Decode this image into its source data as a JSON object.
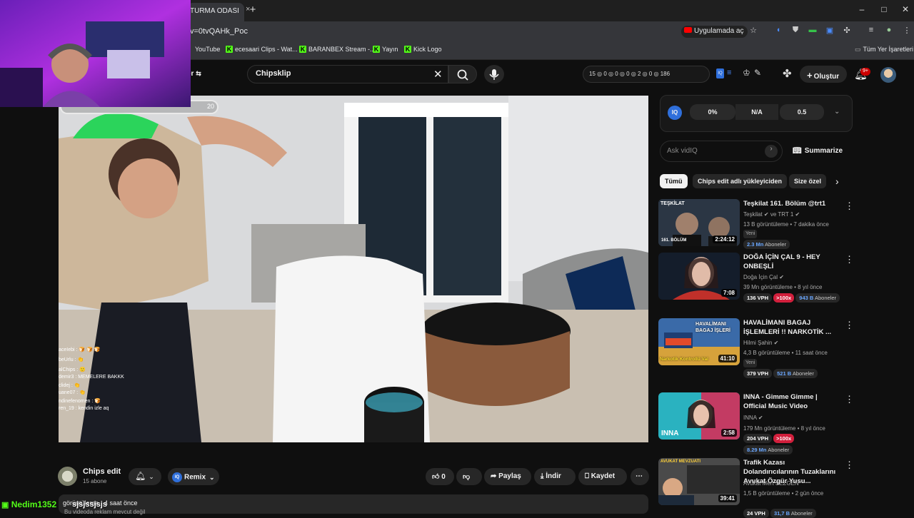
{
  "browser": {
    "tab_title": "TURMA ODASI",
    "tab_close": "×",
    "new_tab": "+",
    "window_controls": [
      "–",
      "□",
      "✕"
    ],
    "url": "v=0tvQAHk_Poc",
    "open_in_app": "Uygulamada aç",
    "bookmarks": [
      {
        "label": "YouTube",
        "icon": "youtube-icon"
      },
      {
        "label": "ecesaari Clips - Wat...",
        "icon": "kick-icon"
      },
      {
        "label": "BARANBEX Stream -...",
        "icon": "kick-icon"
      },
      {
        "label": "Yayın",
        "icon": "kick-icon"
      },
      {
        "label": "Kick Logo",
        "icon": "kick-icon"
      }
    ],
    "all_bookmarks": "Tüm Yer İşaretleri"
  },
  "youtube": {
    "filter_label": "er",
    "search_value": "Chipsklip",
    "vidiq_stats": "15 ◎ 0 ◎ 0 ◎ 0 ◎ 2 ◎ 0 ◎ 186",
    "create_label": "Oluştur",
    "notif_badge": "9+"
  },
  "video": {
    "viewer_count": "20",
    "chat": [
      "aceIebi : 🍞 🍞 🍞",
      "beUrlu : 👏",
      "alChips : 🙂",
      "demir3 : MEMELERE BAKKK",
      "clidej : 👏",
      "uane07 : 👏",
      "ndinefenomen : 🍞",
      "ren_19 : kendin izle aq"
    ]
  },
  "channel": {
    "name": "Chips edit",
    "subscribers": "15 abone",
    "remix_label": "Remix",
    "like_count": "0",
    "share_label": "Paylaş",
    "download_label": "İndir",
    "save_label": "Kaydet",
    "more": "⋯"
  },
  "description": {
    "meta": "görüntüleme · 4 saat önce",
    "sub": "Bu videoda reklam mevcut değil"
  },
  "stream_overlay": {
    "user": "Nedim1352",
    "message": "sjsjssjsjs"
  },
  "vidiq": {
    "logo": "IQ",
    "scores": [
      "0%",
      "N/A",
      "0.5"
    ],
    "ask_placeholder": "Ask vidIQ",
    "summarize_label": "Summarize"
  },
  "chips": [
    "Tümü",
    "Chips edit adlı yükleyiciden",
    "Size özel"
  ],
  "recommendations": [
    {
      "title": "Teşkilat 161. Bölüm @trt1",
      "channel": "Teşkilat ✔ ve TRT 1 ✔",
      "meta": "13 B görüntüleme • 7 dakika önce",
      "badge": "Yeni",
      "duration": "2:24:12",
      "vph": "",
      "mult": "",
      "subs_num": "2.3 Mn",
      "subs_label": "Aboneler",
      "thumb_color": "#2a3340",
      "thumb_text": "TEŞKİLAT",
      "thumb_sub": "161. BÖLÜM"
    },
    {
      "title": "DOĞA İÇİN ÇAL 9 - HEY ONBEŞLİ",
      "channel": "Doğa İçin Çal ✔",
      "meta": "39 Mn görüntüleme • 8 yıl önce",
      "badge": "",
      "duration": "7:08",
      "vph": "136 VPH",
      "mult": ">100x",
      "subs_num": "943 B",
      "subs_label": "Aboneler",
      "thumb_color": "#141d2b",
      "thumb_text": "",
      "thumb_sub": ""
    },
    {
      "title": "HAVALİMANI BAGAJ İŞLEMLERİ !! NARKOTİK ...",
      "channel": "Hilmi Şahin ✔",
      "meta": "4,3 B görüntüleme • 11 saat önce",
      "badge": "Yeni",
      "duration": "41:10",
      "vph": "379 VPH",
      "mult": "",
      "subs_num": "521 B",
      "subs_label": "Aboneler",
      "thumb_color": "#3a6aa8",
      "thumb_text": "HAVALİMANI BAGAJ İŞLERİ",
      "thumb_sub": "Narkotik Kontrollü Val"
    },
    {
      "title": "INNA - Gimme Gimme | Official Music Video",
      "channel": "INNA ✔",
      "meta": "179 Mn görüntüleme • 8 yıl önce",
      "badge": "",
      "duration": "2:58",
      "vph": "204 VPH",
      "mult": ">100x",
      "subs_num": "8.29 Mn",
      "subs_label": "Aboneler",
      "thumb_color": "#c33b63",
      "thumb_text": "INNA",
      "thumb_sub": ""
    },
    {
      "title": "Trafik Kazası Dolandırıcılarının Tuzaklarını Avukat Özgür Yusu...",
      "channel": "Avukat Mert SEZGEN",
      "meta": "1,5 B görüntüleme • 2 gün önce",
      "badge": "",
      "duration": "39:41",
      "vph": "24 VPH",
      "mult": "",
      "subs_num": "31,7 B",
      "subs_label": "Aboneler",
      "thumb_color": "#4a4a4a",
      "thumb_text": "AVUKAT MEVZUATI",
      "thumb_sub": ""
    }
  ]
}
